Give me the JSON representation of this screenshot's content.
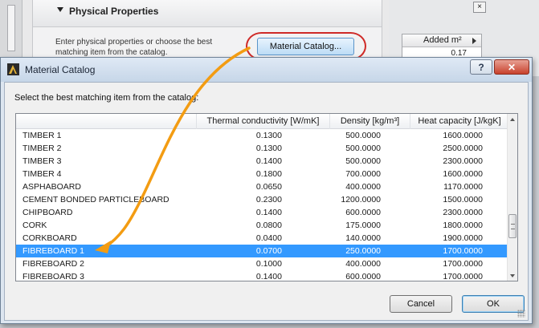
{
  "background": {
    "section_title": "Physical Properties",
    "description": "Enter physical properties or choose the best matching item from the catalog.",
    "catalog_button_label": "Material Catalog...",
    "close_glyph": "×",
    "table_header": "Added m²",
    "table_value": "0.17"
  },
  "dialog": {
    "title": "Material Catalog",
    "help_glyph": "?",
    "close_glyph": "✕",
    "instruction": "Select the best matching item from the catalog:",
    "columns": [
      "Thermal conductivity [W/mK]",
      "Density [kg/m³]",
      "Heat capacity [J/kgK]"
    ],
    "rows": [
      {
        "name": "TIMBER 1",
        "thermal": "0.1300",
        "density": "500.0000",
        "heat": "1600.0000"
      },
      {
        "name": "TIMBER 2",
        "thermal": "0.1300",
        "density": "500.0000",
        "heat": "2500.0000"
      },
      {
        "name": "TIMBER 3",
        "thermal": "0.1400",
        "density": "500.0000",
        "heat": "2300.0000"
      },
      {
        "name": "TIMBER 4",
        "thermal": "0.1800",
        "density": "700.0000",
        "heat": "1600.0000"
      },
      {
        "name": "ASPHABOARD",
        "thermal": "0.0650",
        "density": "400.0000",
        "heat": "1170.0000"
      },
      {
        "name": "CEMENT BONDED PARTICLEBOARD",
        "thermal": "0.2300",
        "density": "1200.0000",
        "heat": "1500.0000"
      },
      {
        "name": "CHIPBOARD",
        "thermal": "0.1400",
        "density": "600.0000",
        "heat": "2300.0000"
      },
      {
        "name": "CORK",
        "thermal": "0.0800",
        "density": "175.0000",
        "heat": "1800.0000"
      },
      {
        "name": "CORKBOARD",
        "thermal": "0.0400",
        "density": "140.0000",
        "heat": "1900.0000"
      },
      {
        "name": "FIBREBOARD 1",
        "thermal": "0.0700",
        "density": "250.0000",
        "heat": "1700.0000"
      },
      {
        "name": "FIBREBOARD 2",
        "thermal": "0.1000",
        "density": "400.0000",
        "heat": "1700.0000"
      },
      {
        "name": "FIBREBOARD 3",
        "thermal": "0.1400",
        "density": "600.0000",
        "heat": "1700.0000"
      }
    ],
    "selected_row": "FIBREBOARD 1",
    "cancel_label": "Cancel",
    "ok_label": "OK"
  },
  "colors": {
    "selection": "#3399ff",
    "annotation_arrow": "#f39c12",
    "highlight_ellipse": "#cf2a27"
  }
}
